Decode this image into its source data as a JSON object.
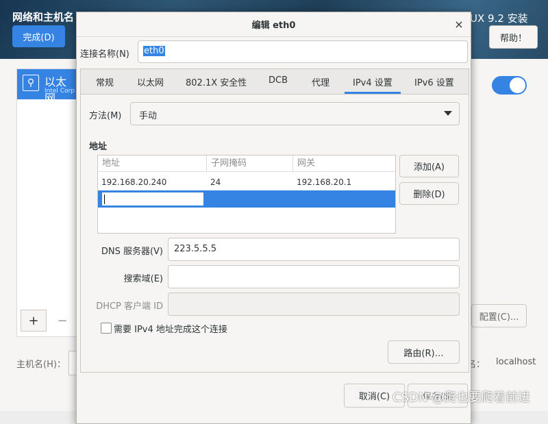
{
  "background": {
    "title": "网络和主机名",
    "right_title": "UX 9.2 安装",
    "done_button": "完成(D)",
    "help_button": "帮助！",
    "list_item": {
      "name": "以太网",
      "subtitle": "Intel Corp"
    },
    "add_button": "+",
    "remove_button": "−",
    "configure_button": "配置(C)...",
    "hostname_label": "主机名(H)：",
    "current_hostname_label": "名：",
    "current_hostname_value": "localhost",
    "toggle_on": true
  },
  "dialog": {
    "title": "编辑 eth0",
    "close_icon": "×",
    "connection_name_label": "连接名称(N)",
    "connection_name_value": "eth0",
    "tabs": [
      {
        "label": "常规"
      },
      {
        "label": "以太网"
      },
      {
        "label": "802.1X 安全性"
      },
      {
        "label": "DCB"
      },
      {
        "label": "代理"
      },
      {
        "label": "IPv4 设置"
      },
      {
        "label": "IPv6 设置"
      }
    ],
    "active_tab": "IPv4 设置",
    "method_label": "方法(M)",
    "method_value": "手动",
    "addresses_heading": "地址",
    "address_columns": [
      "地址",
      "子网掩码",
      "网关"
    ],
    "address_rows": [
      {
        "address": "192.168.20.240",
        "netmask": "24",
        "gateway": "192.168.20.1"
      }
    ],
    "add_button": "添加(A)",
    "delete_button": "删除(D)",
    "dns_label": "DNS 服务器(V)",
    "dns_value": "223.5.5.5",
    "search_domain_label": "搜索域(E)",
    "search_domain_value": "",
    "dhcp_client_id_label": "DHCP 客户端 ID",
    "dhcp_client_id_value": "",
    "require_ipv4_label": "需要 IPv4 地址完成这个连接",
    "require_ipv4_checked": false,
    "routes_button": "路由(R)…",
    "cancel_button": "取消(C)",
    "save_button": "保存(S)"
  },
  "watermark": "CSDN @爬也要爬着前进",
  "colors": {
    "accent": "#3584e4",
    "header_bg": "#2a4a63"
  }
}
